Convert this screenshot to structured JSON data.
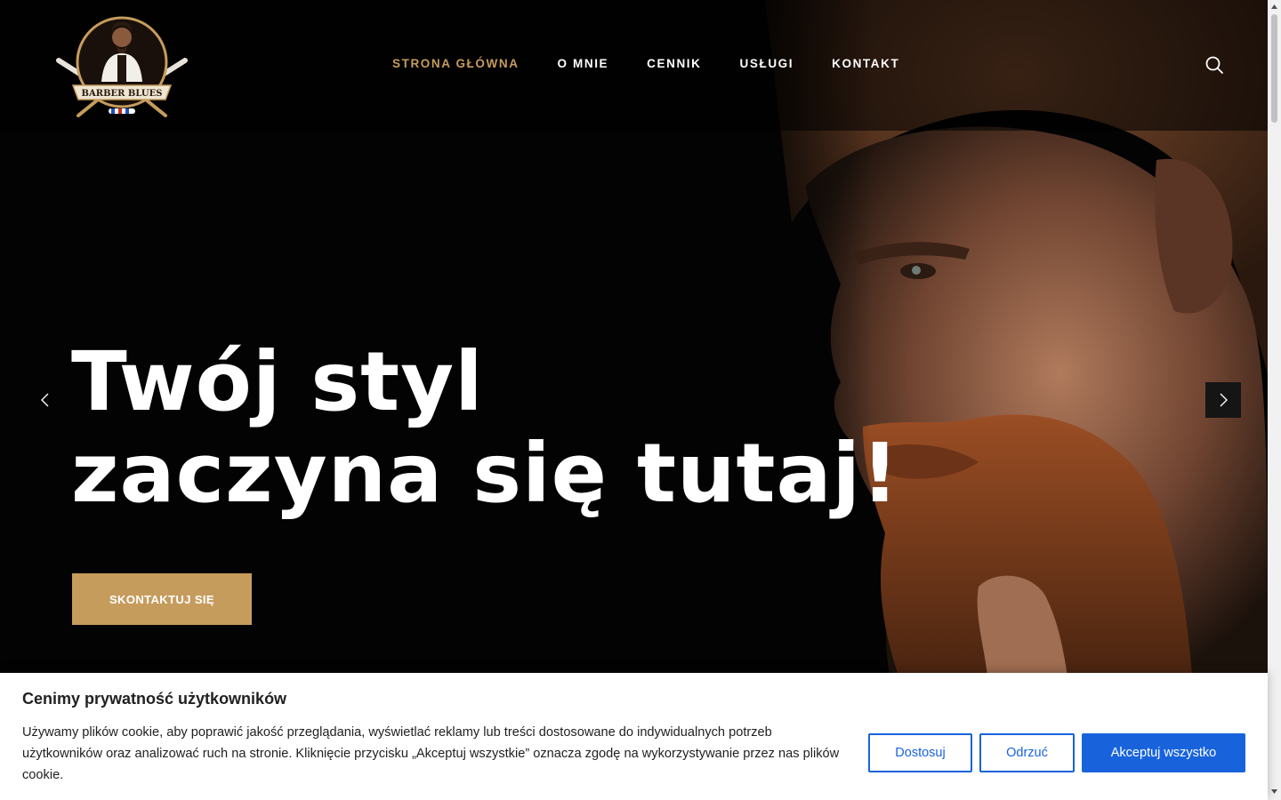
{
  "brand": {
    "logo_text": "BARBER BLUES"
  },
  "nav": {
    "items": [
      {
        "label": "STRONA GŁÓWNA",
        "active": true
      },
      {
        "label": "O MNIE",
        "active": false
      },
      {
        "label": "CENNIK",
        "active": false
      },
      {
        "label": "USŁUGI",
        "active": false
      },
      {
        "label": "KONTAKT",
        "active": false
      }
    ],
    "search_icon": "search-icon"
  },
  "hero": {
    "headline_line1": "Twój styl",
    "headline_line2": "zaczyna się tutaj!",
    "cta_label": "SKONTAKTUJ SIĘ",
    "prev_icon": "chevron-left-icon",
    "next_icon": "chevron-right-icon"
  },
  "cookie": {
    "title": "Cenimy prywatność użytkowników",
    "text": "Używamy plików cookie, aby poprawić jakość przeglądania, wyświetlać reklamy lub treści dostosowane do indywidualnych potrzeb użytkowników oraz analizować ruch na stronie. Kliknięcie przycisku „Akceptuj wszystkie” oznacza zgodę na wykorzystywanie przez nas plików cookie.",
    "customize_label": "Dostosuj",
    "reject_label": "Odrzuć",
    "accept_label": "Akceptuj wszystko"
  },
  "colors": {
    "accent_gold": "#c69c5d",
    "cookie_blue": "#1863dc",
    "background": "#030303"
  }
}
